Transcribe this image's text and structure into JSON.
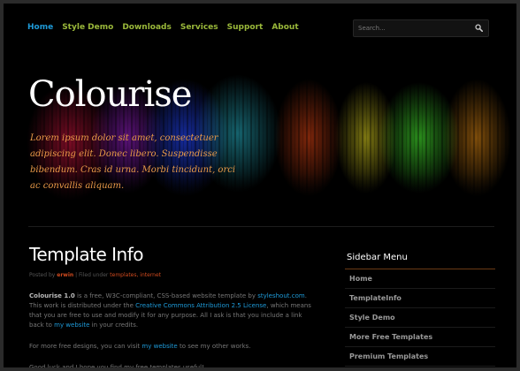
{
  "nav": {
    "items": [
      "Home",
      "Style Demo",
      "Downloads",
      "Services",
      "Support",
      "About"
    ]
  },
  "search": {
    "placeholder": "Search..."
  },
  "hero": {
    "title": "Colourise",
    "tagline": "Lorem ipsum dolor sit amet, consectetuer adipiscing elit. Donec libero. Suspendisse bibendum. Cras id urna. Morbi tincidunt, orci ac convallis aliquam."
  },
  "post": {
    "title": "Template Info",
    "meta": {
      "posted_by": "Posted by",
      "author": "erwin",
      "separator": "|",
      "filed_under": "Filed under",
      "tags": "templates, internet"
    },
    "p1": {
      "strong": "Colourise 1.0",
      "t1": " is a free, W3C-compliant, CSS-based website template by ",
      "link1": "styleshout.com",
      "t2": ". This work is distributed under the ",
      "link2": "Creative Commons Attribution 2.5 License",
      "t3": ", which means that you are free to use and modify it for any purpose. All I ask is that you include a link back to ",
      "link3": "my website",
      "t4": " in your credits."
    },
    "p2": {
      "t1": "For more free designs, you can visit ",
      "link1": "my website",
      "t2": " to see my other works."
    },
    "p3": "Good luck and I hope you find my free templates useful!"
  },
  "sidebar": {
    "title": "Sidebar Menu",
    "items": [
      "Home",
      "TemplateInfo",
      "Style Demo",
      "More Free Templates",
      "Premium Templates"
    ]
  },
  "colors": {
    "nav_active": "#1e9ad8",
    "nav_link": "#9ab83a",
    "tagline": "#e89a48",
    "accent_orange": "#d04a1e",
    "link_blue": "#1e9ad8"
  },
  "icons": {
    "search": "magnifier-icon"
  }
}
